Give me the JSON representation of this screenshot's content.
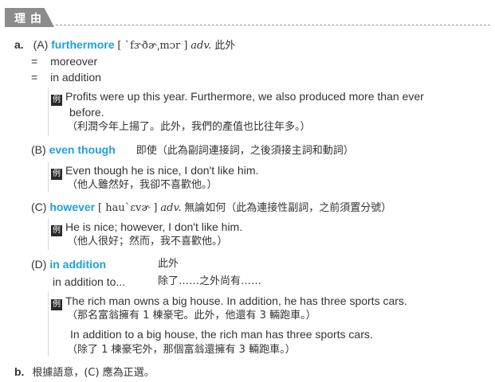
{
  "header": {
    "title": "理由"
  },
  "a": {
    "label": "a.",
    "A": {
      "tag": "(A)",
      "word": "furthermore",
      "phon": "[ ˋfɝðɚ͵mɔr ]",
      "pos": "adv.",
      "meaning": "此外",
      "syn1_eq": "=",
      "syn1": "moreover",
      "syn2_eq": "=",
      "syn2": "in addition",
      "ex_badge": "例",
      "ex_en1": "Profits were up this year. Furthermore, we also produced more than ever",
      "ex_en2": "before.",
      "ex_zh": "（利潤今年上揚了。此外，我們的產值也比往年多。）"
    },
    "B": {
      "tag": "(B)",
      "word": "even though",
      "meaning": "即使（此為副詞連接詞，之後須接主詞和動詞）",
      "ex_badge": "例",
      "ex_en": "Even though he is nice, I don't like him.",
      "ex_zh": "（他人雖然好，我卻不喜歡他。）"
    },
    "C": {
      "tag": "(C)",
      "word": "however",
      "phon": "[ hauˋɛvɚ ]",
      "pos": "adv.",
      "meaning": "無論如何（此為連接性副詞，之前須置分號）",
      "ex_badge": "例",
      "ex_en": "He is nice; however, I don't like him.",
      "ex_zh": "（他人很好；然而，我不喜歡他。）"
    },
    "D": {
      "tag": "(D)",
      "word": "in addition",
      "meaning": "此外",
      "phrase2": "in addition to...",
      "meaning2": "除了……之外尚有……",
      "ex_badge": "例",
      "ex1_en": "The rich man owns a big house. In addition, he has three sports cars.",
      "ex1_zh": "（那名富翁擁有 1 棟豪宅。此外，他還有 3 輛跑車。）",
      "ex2_en": "In addition to a big house, the rich man has three sports cars.",
      "ex2_zh": "（除了 1 棟豪宅外，那個富翁還擁有 3 輛跑車。）"
    }
  },
  "b": {
    "label": "b.",
    "text": "根據語意，(C) 應為正選。"
  }
}
